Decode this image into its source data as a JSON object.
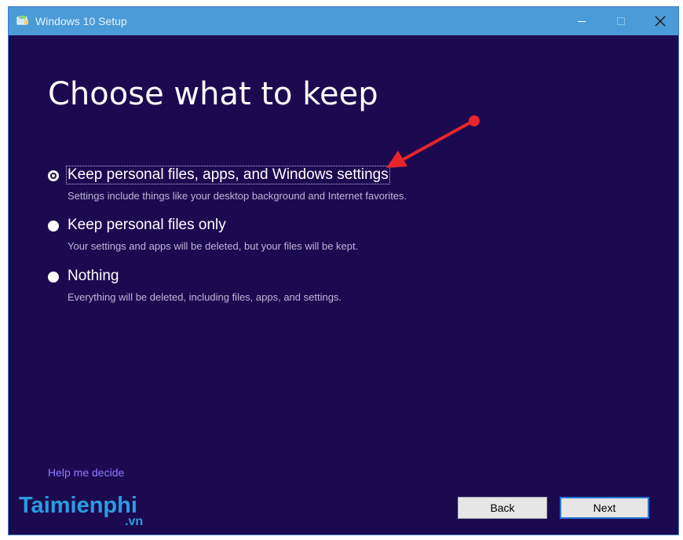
{
  "window": {
    "title": "Windows 10 Setup",
    "controls": {
      "minimize": "minimize-icon",
      "maximize": "maximize-icon",
      "close": "close-icon"
    }
  },
  "page": {
    "heading": "Choose what to keep",
    "options": [
      {
        "label": "Keep personal files, apps, and Windows settings",
        "description": "Settings include things like your desktop background and Internet favorites.",
        "selected": true
      },
      {
        "label": "Keep personal files only",
        "description": "Your settings and apps will be deleted, but your files will be kept.",
        "selected": false
      },
      {
        "label": "Nothing",
        "description": "Everything will be deleted, including files, apps, and settings.",
        "selected": false
      }
    ],
    "help_link": "Help me decide"
  },
  "buttons": {
    "back": "Back",
    "next": "Next"
  },
  "watermark": {
    "main": "Taimienphi",
    "sub": ".vn"
  },
  "colors": {
    "titlebar": "#4a9bd8",
    "background": "#1c0a51",
    "link": "#8c7bff",
    "annotation_arrow": "#e8252a",
    "watermark": "#2d9ce0"
  }
}
